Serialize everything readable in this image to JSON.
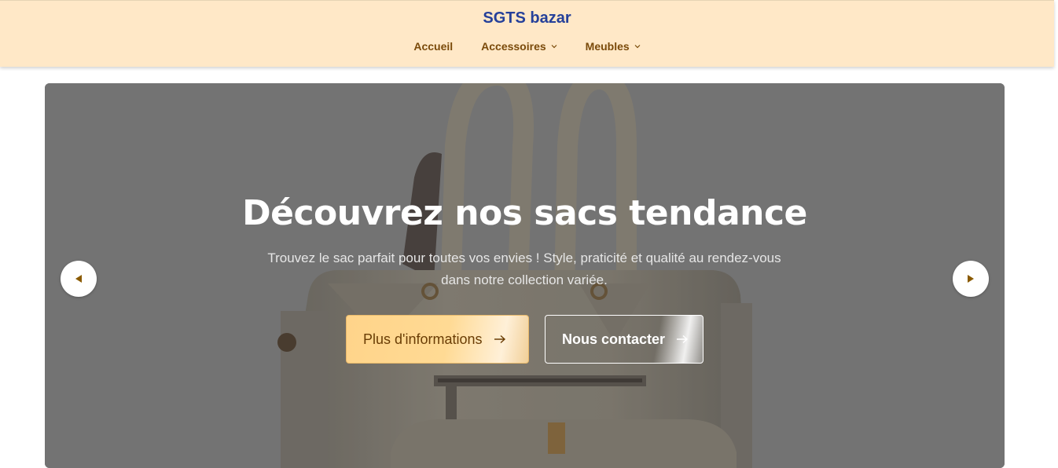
{
  "header": {
    "brand": "SGTS bazar",
    "nav": [
      {
        "label": "Accueil",
        "has_dropdown": false
      },
      {
        "label": "Accessoires",
        "has_dropdown": true
      },
      {
        "label": "Meubles",
        "has_dropdown": true
      }
    ]
  },
  "hero": {
    "title": "Découvrez nos sacs tendance",
    "subtitle": "Trouvez le sac parfait pour toutes vos envies ! Style, praticité et qualité au rendez-vous dans notre collection variée.",
    "primary_button": "Plus d'informations",
    "secondary_button": "Nous contacter",
    "prev_icon": "caret-left-icon",
    "next_icon": "caret-right-icon",
    "image": "handbag-photo"
  },
  "colors": {
    "header_bg": "#ffe8c7",
    "brand": "#25409a",
    "nav_text": "#7a4a0a",
    "primary_button": "#ffd48a",
    "carousel_arrow": "#8a5a00"
  }
}
